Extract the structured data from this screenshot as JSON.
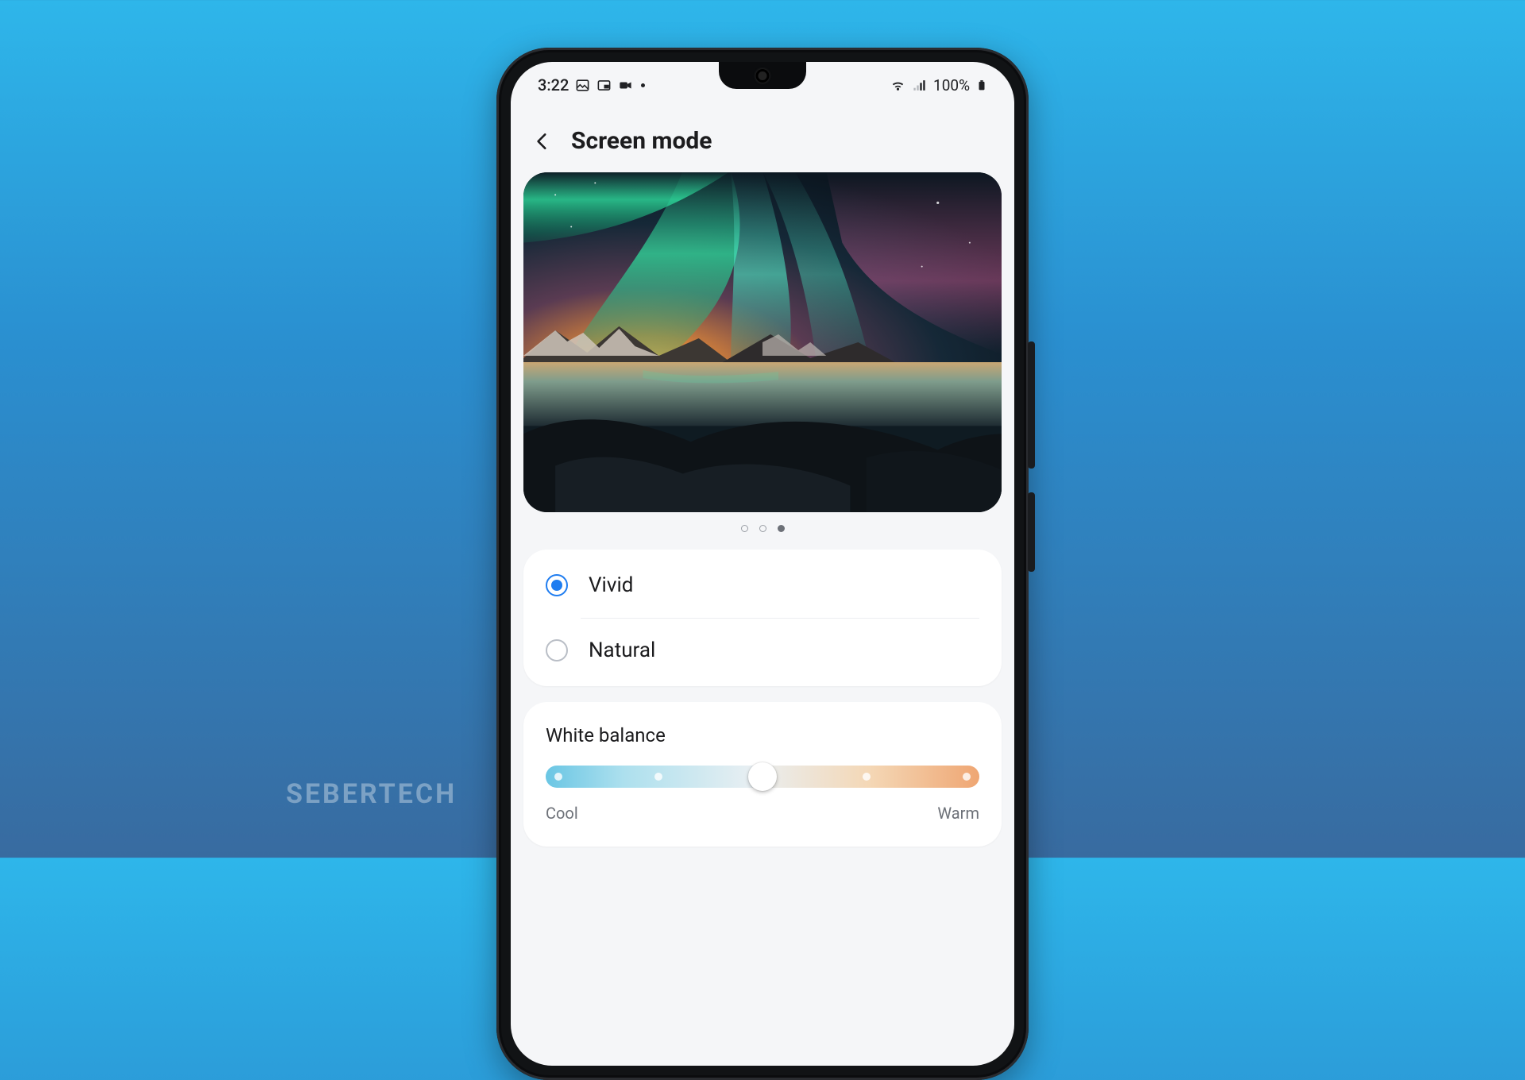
{
  "watermark": "SEBERTECH",
  "status": {
    "time": "3:22",
    "battery_pct": "100%"
  },
  "header": {
    "title": "Screen mode"
  },
  "pager": {
    "active_index": 2,
    "count": 3
  },
  "modes": {
    "vivid": "Vivid",
    "natural": "Natural",
    "selected": "vivid"
  },
  "white_balance": {
    "title": "White balance",
    "cool_label": "Cool",
    "warm_label": "Warm",
    "value_pct": 50
  }
}
